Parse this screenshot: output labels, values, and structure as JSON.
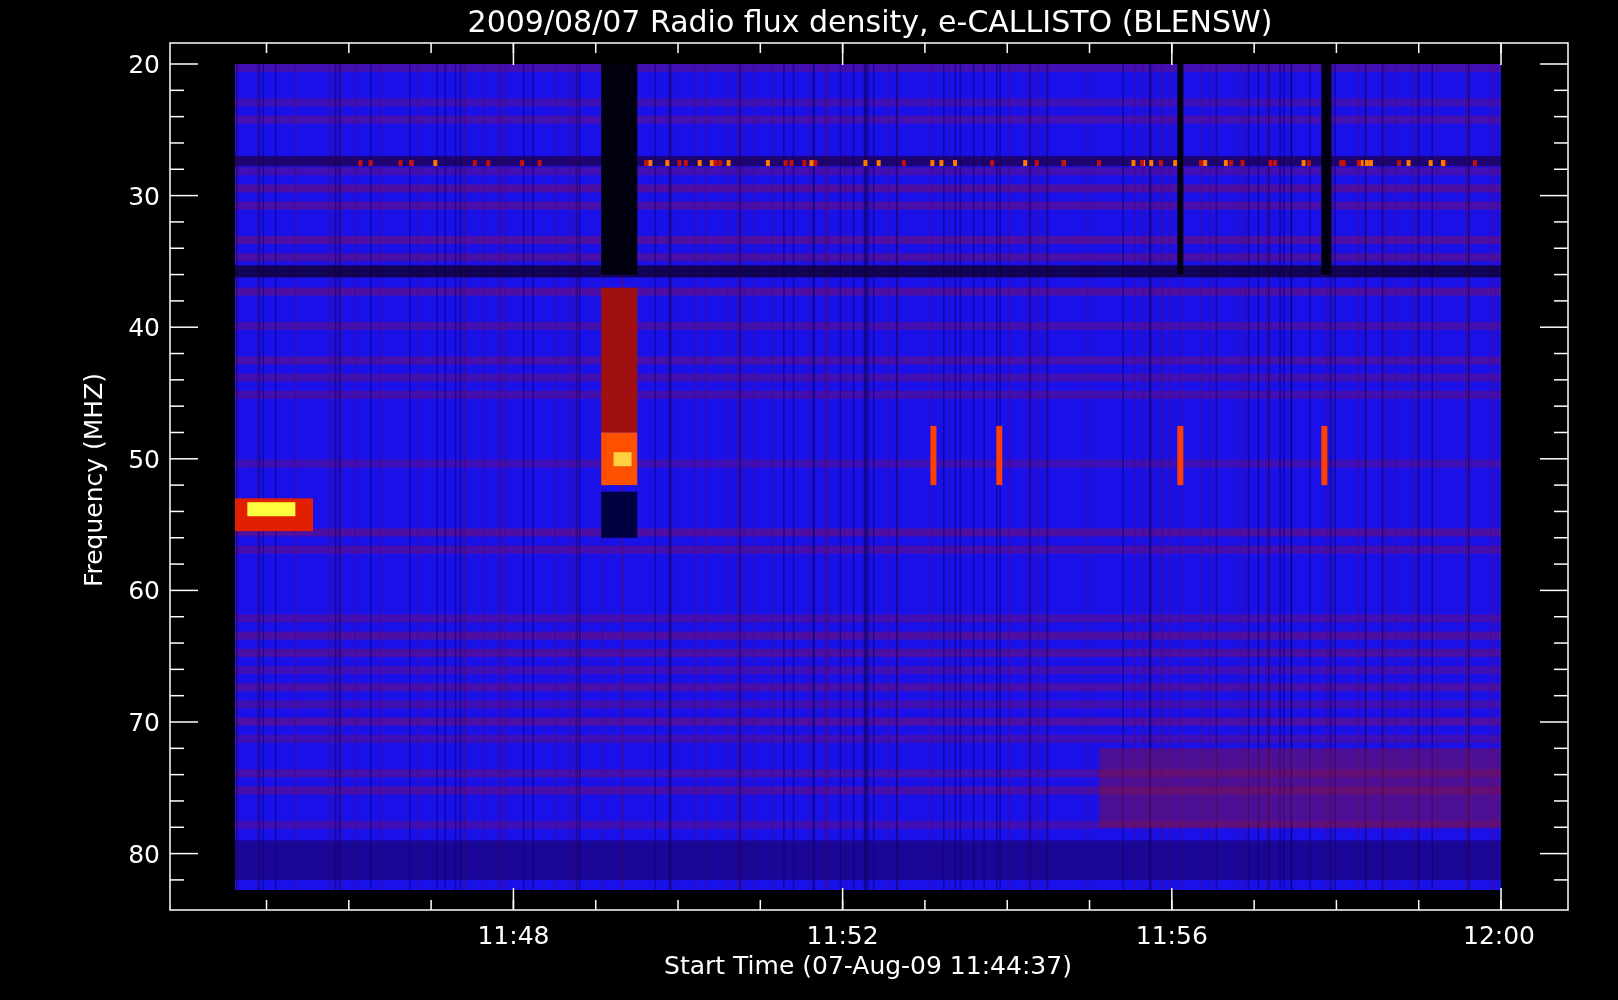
{
  "title": "2009/08/07  Radio flux density, e-CALLISTO (BLENSW)",
  "y_axis": {
    "label": "Frequency (MHZ)",
    "ticks": [
      "20",
      "30",
      "40",
      "50",
      "60",
      "70",
      "80"
    ]
  },
  "x_axis": {
    "label": "Start Time (07-Aug-09 11:44:37)",
    "ticks": [
      "11:48",
      "11:52",
      "11:56",
      "12:00"
    ]
  }
}
